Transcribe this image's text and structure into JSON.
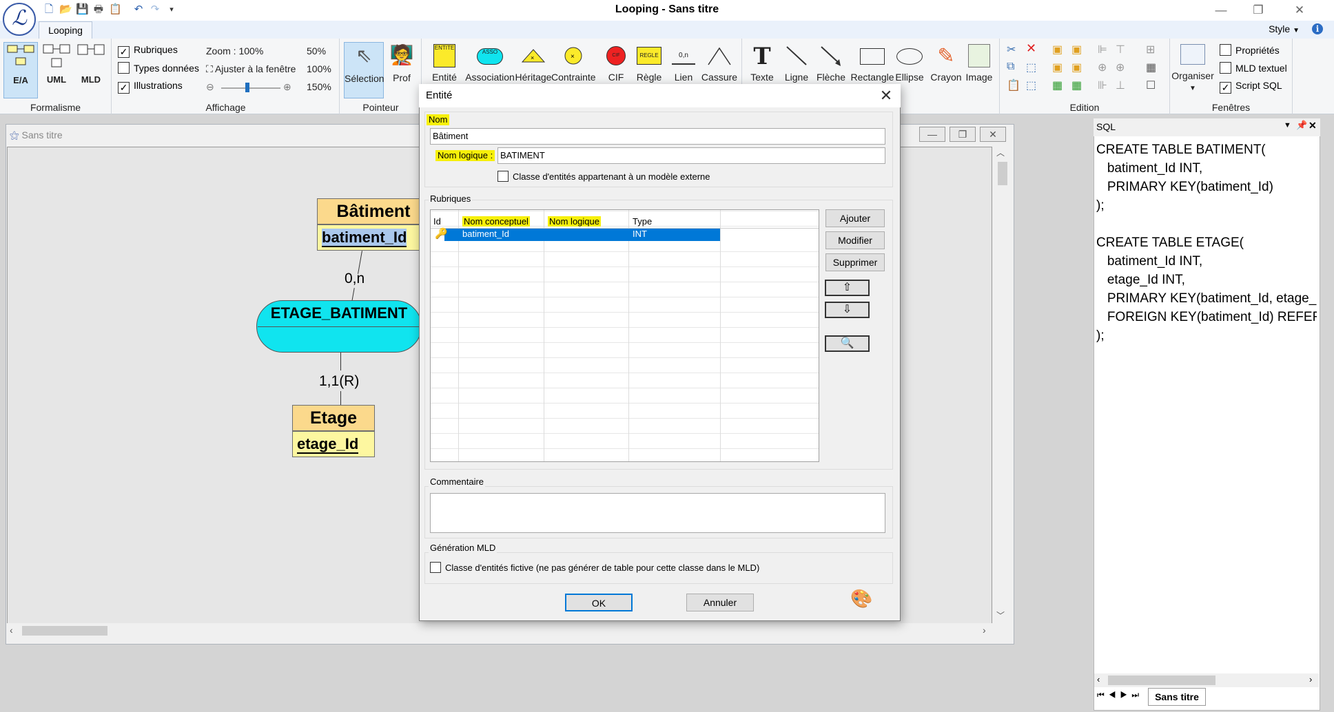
{
  "app": {
    "title": "Looping - Sans titre",
    "logo_text": "ℒ"
  },
  "tabs": {
    "main": "Looping",
    "style_menu": "Style"
  },
  "ribbon": {
    "formalisme": {
      "label": "Formalisme",
      "buttons": [
        "E/A",
        "UML",
        "MLD"
      ]
    },
    "affichage": {
      "label": "Affichage",
      "rubriques": "Rubriques",
      "types": "Types données",
      "illustrations": "Illustrations",
      "zoom": "Zoom : 100%",
      "ajuster": "Ajuster à la fenêtre",
      "z50": "50%",
      "z100": "100%",
      "z150": "150%"
    },
    "pointeur": {
      "label": "Pointeur",
      "selection": "Sélection",
      "prof": "Prof"
    },
    "tools": [
      "Entité",
      "Association",
      "Héritage",
      "Contrainte",
      "CIF",
      "Règle",
      "Lien",
      "Cassure",
      "Texte",
      "Ligne",
      "Flèche",
      "Rectangle",
      "Ellipse",
      "Crayon",
      "Image"
    ],
    "tool_icon_text": {
      "entite": "ENTITE",
      "asso": "ASSO",
      "cif": "CIF",
      "regle": "REGLE",
      "lien": "0,n"
    },
    "edition": {
      "label": "Edition"
    },
    "fenetres": {
      "label": "Fenêtres",
      "organiser": "Organiser",
      "proprietes": "Propriétés",
      "mld_textuel": "MLD textuel",
      "script_sql": "Script SQL"
    }
  },
  "canvas": {
    "title": "Sans titre",
    "entity1": {
      "name": "Bâtiment",
      "field": "batiment_Id"
    },
    "assoc": {
      "name": "ETAGE_BATIMENT"
    },
    "card1": "0,n",
    "card2": "1,1(R)",
    "entity2": {
      "name": "Etage",
      "field": "etage_Id"
    }
  },
  "sql": {
    "header": "SQL",
    "text": "CREATE TABLE BATIMENT(\n   batiment_Id INT,\n   PRIMARY KEY(batiment_Id)\n);\n\nCREATE TABLE ETAGE(\n   batiment_Id INT,\n   etage_Id INT,\n   PRIMARY KEY(batiment_Id, etage_\n   FOREIGN KEY(batiment_Id) REFER\n);",
    "tab": "Sans titre"
  },
  "dialog": {
    "title": "Entité",
    "nom_label": "Nom",
    "nom_value": "Bâtiment",
    "nom_logique_label": "Nom logique :",
    "nom_logique_value": "BATIMENT",
    "externe": "Classe d'entités appartenant à un modèle externe",
    "rubriques_label": "Rubriques",
    "columns": [
      "Id",
      "Nom conceptuel",
      "Nom logique",
      "Type"
    ],
    "row": {
      "nom": "batiment_Id",
      "logique": "",
      "type": "INT"
    },
    "ajouter": "Ajouter",
    "modifier": "Modifier",
    "supprimer": "Supprimer",
    "up": "⇧",
    "down": "⇩",
    "key": "🔍",
    "commentaire_label": "Commentaire",
    "mld_label": "Génération MLD",
    "fictive": "Classe d'entités fictive (ne pas générer de table pour cette classe dans le MLD)",
    "ok": "OK",
    "annuler": "Annuler"
  },
  "colors": {
    "accent": "#0078d7",
    "highlight": "#f7f00a",
    "entity_header": "#fbd98c",
    "entity_body": "#fdf7a0",
    "association": "#10e4ef"
  }
}
